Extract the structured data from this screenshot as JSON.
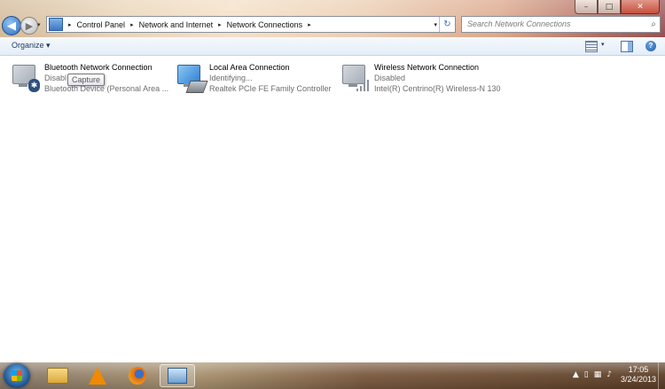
{
  "window": {
    "minimize_glyph": "–",
    "maximize_glyph": "□",
    "close_glyph": "✕"
  },
  "nav": {
    "back_glyph": "◀",
    "forward_glyph": "▶",
    "dropdown_glyph": "▾"
  },
  "address": {
    "crumbs": [
      "Control Panel",
      "Network and Internet",
      "Network Connections"
    ],
    "separator": "▸",
    "dropdown_glyph": "▾",
    "refresh_glyph": "↻"
  },
  "search": {
    "placeholder": "Search Network Connections",
    "icon_glyph": "⌕"
  },
  "toolbar": {
    "organize_label": "Organize ▾",
    "view_dropdown_glyph": "▾",
    "help_glyph": "?"
  },
  "connections": [
    {
      "name": "Bluetooth Network Connection",
      "status": "Disabled",
      "status_visible": "Disabl",
      "device": "Bluetooth Device (Personal Area ...",
      "icon": "bluetooth-network-icon"
    },
    {
      "name": "Local Area Connection",
      "status": "Identifying...",
      "device": "Realtek PCIe FE Family Controller",
      "icon": "wired-network-icon"
    },
    {
      "name": "Wireless Network Connection",
      "status": "Disabled",
      "device": "Intel(R) Centrino(R) Wireless-N 130",
      "icon": "wireless-network-icon"
    }
  ],
  "tooltip": {
    "text": "Capture"
  },
  "taskbar": {
    "pinned": [
      "windows-explorer",
      "vlc-media-player",
      "firefox",
      "network-connections"
    ],
    "tray_glyphs": [
      "▲",
      "▯",
      "▦",
      "♪"
    ],
    "clock_time": "17:05",
    "clock_date": "3/24/2013"
  }
}
